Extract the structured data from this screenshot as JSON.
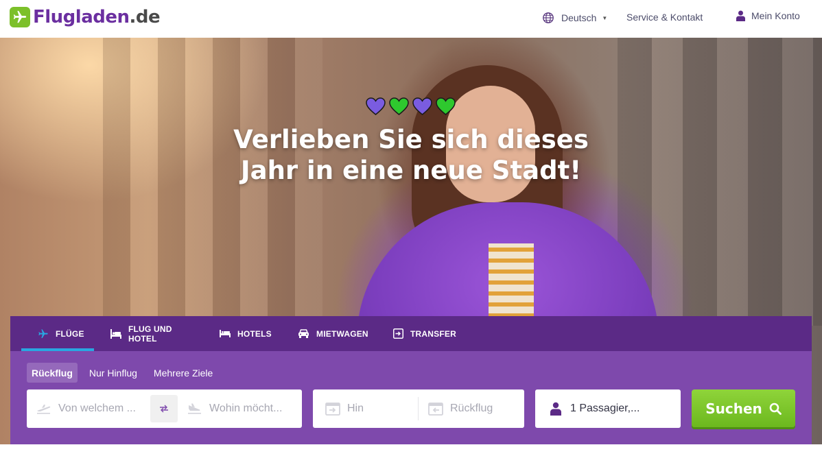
{
  "header": {
    "logo_main": "Flugladen",
    "logo_tld": ".de",
    "language": "Deutsch",
    "service": "Service & Kontakt",
    "account": "Mein Konto"
  },
  "hero": {
    "headline_line1": "Verlieben Sie sich dieses",
    "headline_line2": "Jahr in eine neue Stadt!",
    "hearts": [
      "purple-heart-icon",
      "green-heart-icon",
      "purple-heart-icon",
      "green-heart-icon"
    ]
  },
  "search": {
    "tabs": [
      {
        "label": "FLÜGE",
        "icon": "plane-icon",
        "active": true
      },
      {
        "label": "FLUG UND HOTEL",
        "icon": "bed-icon"
      },
      {
        "label": "HOTELS",
        "icon": "hotel-bed-icon"
      },
      {
        "label": "MIETWAGEN",
        "icon": "car-icon"
      },
      {
        "label": "TRANSFER",
        "icon": "transfer-icon"
      }
    ],
    "trip_types": [
      {
        "label": "Rückflug",
        "active": true
      },
      {
        "label": "Nur Hinflug"
      },
      {
        "label": "Mehrere Ziele"
      }
    ],
    "from_placeholder": "Von welchem ...",
    "to_placeholder": "Wohin möcht...",
    "depart_placeholder": "Hin",
    "return_placeholder": "Rückflug",
    "passengers": "1 Passagier,...",
    "button": "Suchen"
  },
  "colors": {
    "brand_purple": "#6b2fa0",
    "tab_bar": "#5b2a86",
    "panel": "#7e49ac",
    "active_tab_underline": "#29a7e1",
    "search_button": "#7cc02a"
  }
}
